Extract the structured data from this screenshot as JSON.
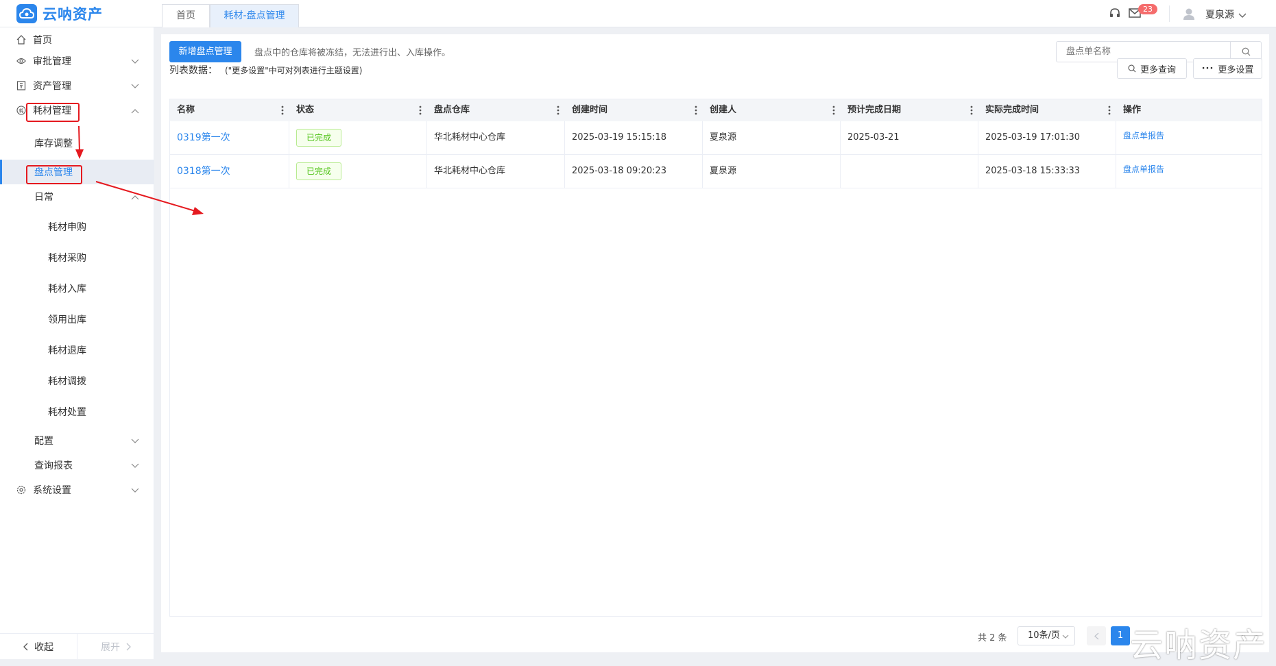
{
  "app": {
    "name": "云呐资产"
  },
  "tabs": [
    {
      "label": "首页",
      "active": false
    },
    {
      "label": "耗材-盘点管理",
      "active": true
    }
  ],
  "header": {
    "notification_count": "23",
    "user_name": "夏泉源"
  },
  "sidebar": {
    "items": [
      {
        "label": "首页",
        "icon": "home-icon"
      },
      {
        "label": "审批管理",
        "icon": "eye-icon"
      },
      {
        "label": "资产管理",
        "icon": "asset-icon"
      },
      {
        "label": "耗材管理",
        "icon": "consumable-icon"
      },
      {
        "label": "库存调整"
      },
      {
        "label": "盘点管理"
      },
      {
        "label": "日常"
      },
      {
        "label": "耗材申购"
      },
      {
        "label": "耗材采购"
      },
      {
        "label": "耗材入库"
      },
      {
        "label": "领用出库"
      },
      {
        "label": "耗材退库"
      },
      {
        "label": "耗材调拨"
      },
      {
        "label": "耗材处置"
      },
      {
        "label": "配置"
      },
      {
        "label": "查询报表"
      },
      {
        "label": "系统设置",
        "icon": "gear-icon"
      }
    ],
    "collapse_label": "收起",
    "expand_label": "展开"
  },
  "toolbar": {
    "new_button": "新增盘点管理",
    "notice": "盘点中的仓库将被冻结，无法进行出、入库操作。",
    "search_placeholder": "盘点单名称",
    "list_title": "列表数据：",
    "list_hint": "(\"更多设置\"中可对列表进行主题设置)",
    "more_query": "更多查询",
    "more_settings": "更多设置"
  },
  "table": {
    "columns": [
      "名称",
      "状态",
      "盘点仓库",
      "创建时间",
      "创建人",
      "预计完成日期",
      "实际完成时间",
      "操作"
    ],
    "rows": [
      {
        "name": "0319第一次",
        "status": "已完成",
        "warehouse": "华北耗材中心仓库",
        "created": "2025-03-19 15:15:18",
        "creator": "夏泉源",
        "planned": "2025-03-21",
        "actual": "2025-03-19 17:01:30",
        "action": "盘点单报告"
      },
      {
        "name": "0318第一次",
        "status": "已完成",
        "warehouse": "华北耗材中心仓库",
        "created": "2025-03-18 09:20:23",
        "creator": "夏泉源",
        "planned": "",
        "actual": "2025-03-18 15:33:33",
        "action": "盘点单报告"
      }
    ]
  },
  "pagination": {
    "total": "共 2 条",
    "page_size": "10条/页",
    "current_page": "1"
  },
  "watermark": "云呐资产",
  "colors": {
    "primary": "#2b86ec",
    "success": "#52c41a",
    "annotation": "#e5191f",
    "badge": "#f56c6c"
  }
}
